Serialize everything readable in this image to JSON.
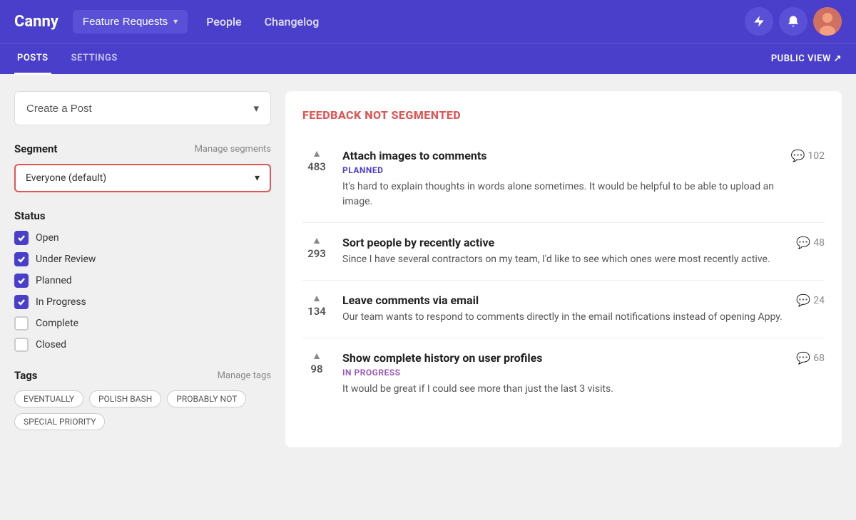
{
  "app": {
    "logo": "Canny"
  },
  "top_nav": {
    "feature_requests_label": "Feature Requests",
    "people_label": "People",
    "changelog_label": "Changelog"
  },
  "sub_nav": {
    "posts_label": "POSTS",
    "settings_label": "SETTINGS",
    "public_view_label": "PUBLIC VIEW ↗"
  },
  "sidebar": {
    "create_post_label": "Create a Post",
    "segment_section_title": "Segment",
    "manage_segments_label": "Manage segments",
    "segment_selected": "Everyone (default)",
    "status_section_title": "Status",
    "statuses": [
      {
        "label": "Open",
        "checked": true
      },
      {
        "label": "Under Review",
        "checked": true
      },
      {
        "label": "Planned",
        "checked": true
      },
      {
        "label": "In Progress",
        "checked": true
      },
      {
        "label": "Complete",
        "checked": false
      },
      {
        "label": "Closed",
        "checked": false
      }
    ],
    "tags_section_title": "Tags",
    "manage_tags_label": "Manage tags",
    "tags": [
      {
        "label": "EVENTUALLY"
      },
      {
        "label": "POLISH BASH"
      },
      {
        "label": "PROBABLY NOT"
      },
      {
        "label": "SPECIAL PRIORITY"
      }
    ]
  },
  "posts_panel": {
    "panel_title": "FEEDBACK NOT SEGMENTED",
    "posts": [
      {
        "votes": 483,
        "title": "Attach images to comments",
        "status": "PLANNED",
        "status_class": "planned",
        "description": "It's hard to explain thoughts in words alone sometimes. It would be helpful to be able to upload an image.",
        "comments": 102,
        "has_status": true
      },
      {
        "votes": 293,
        "title": "Sort people by recently active",
        "status": "",
        "status_class": "",
        "description": "Since I have several contractors on my team, I'd like to see which ones were most recently active.",
        "comments": 48,
        "has_status": false
      },
      {
        "votes": 134,
        "title": "Leave comments via email",
        "status": "",
        "status_class": "",
        "description": "Our team wants to respond to comments directly in the email notifications instead of opening Appy.",
        "comments": 24,
        "has_status": false
      },
      {
        "votes": 98,
        "title": "Show complete history on user profiles",
        "status": "IN PROGRESS",
        "status_class": "in-progress",
        "description": "It would be great if I could see more than just the last 3 visits.",
        "comments": 68,
        "has_status": true
      }
    ]
  }
}
